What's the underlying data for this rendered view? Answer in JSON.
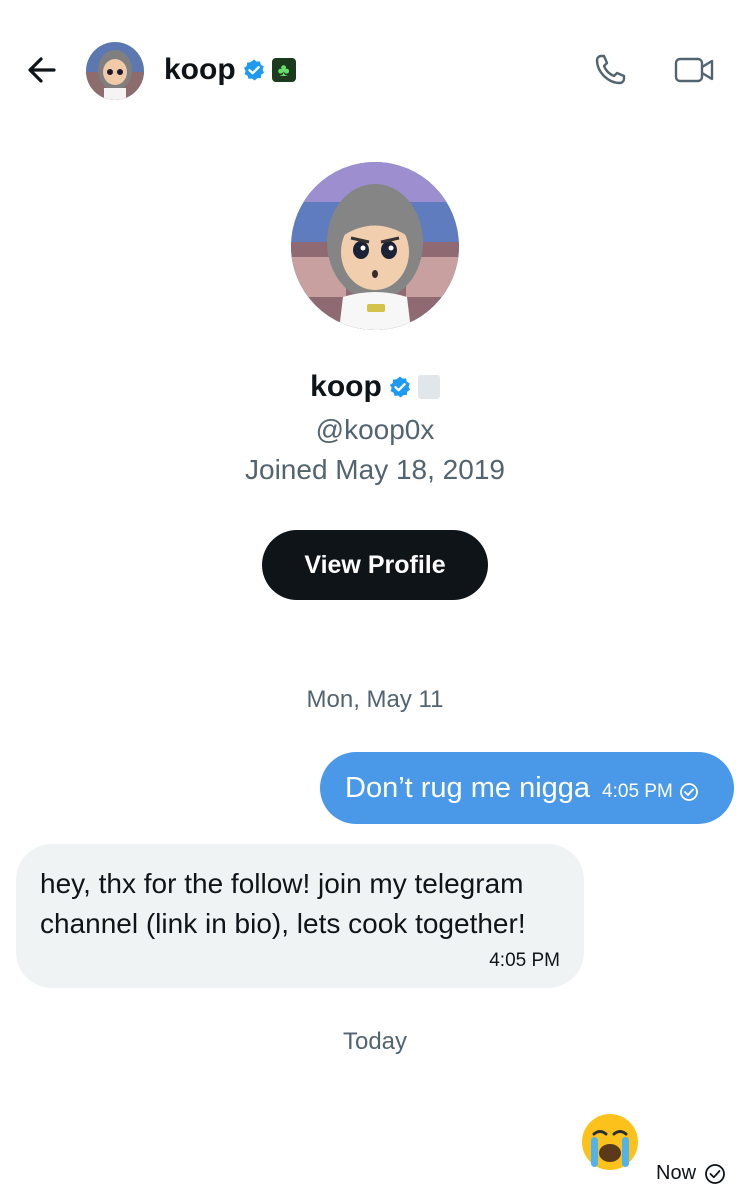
{
  "header": {
    "name": "koop",
    "icons": {
      "back": "arrow-left-icon",
      "verified": "verified-badge-icon",
      "clover": "clover-icon",
      "call": "phone-icon",
      "video": "video-camera-icon"
    }
  },
  "profile": {
    "name": "koop",
    "handle": "@koop0x",
    "joined": "Joined May 18, 2019",
    "view_profile_label": "View Profile"
  },
  "messages": {
    "date1": "Mon, May 11",
    "sent": {
      "text": "Don’t rug me nigga",
      "time": "4:05 PM"
    },
    "received": {
      "text": "hey, thx for the follow! join my telegram channel (link in bio), lets cook together!",
      "time": "4:05 PM"
    },
    "date2": "Today",
    "last": {
      "emoji": "loudly-crying-face",
      "time": "Now"
    }
  },
  "colors": {
    "accent": "#4a99e9",
    "verified": "#1d9bf0",
    "dark_button": "#0f1419",
    "received_bubble": "#eff3f4",
    "muted_text": "#536471"
  }
}
